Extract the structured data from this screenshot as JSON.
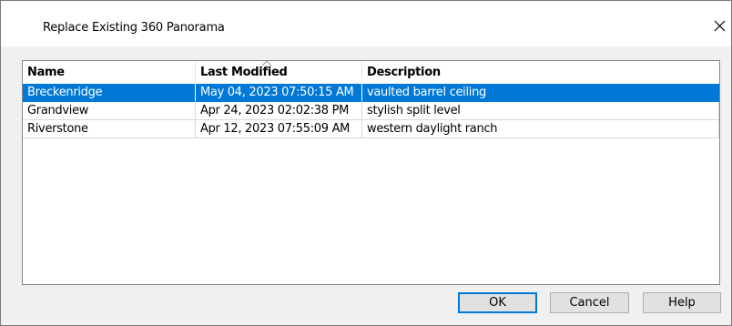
{
  "window": {
    "title": "Replace Existing 360 Panorama"
  },
  "list": {
    "columns": [
      {
        "label": "Name"
      },
      {
        "label": "Last Modified",
        "sorted": "ascending"
      },
      {
        "label": "Description"
      }
    ],
    "rows": [
      {
        "name": "Breckenridge",
        "modified": "May 04, 2023 07:50:15 AM",
        "description": "vaulted barrel ceiling",
        "selected": true
      },
      {
        "name": "Grandview",
        "modified": "Apr 24, 2023 02:02:38 PM",
        "description": "stylish split level",
        "selected": false
      },
      {
        "name": "Riverstone",
        "modified": "Apr 12, 2023 07:55:09 AM",
        "description": "western daylight ranch",
        "selected": false
      }
    ]
  },
  "buttons": {
    "ok": "OK",
    "cancel": "Cancel",
    "help": "Help"
  },
  "colors": {
    "selection": "#0078d7",
    "dialog_bg": "#f0f0f0",
    "button_bg": "#e1e1e1"
  },
  "icons": {
    "close": "close-icon",
    "sort": "sort-ascending-icon"
  }
}
